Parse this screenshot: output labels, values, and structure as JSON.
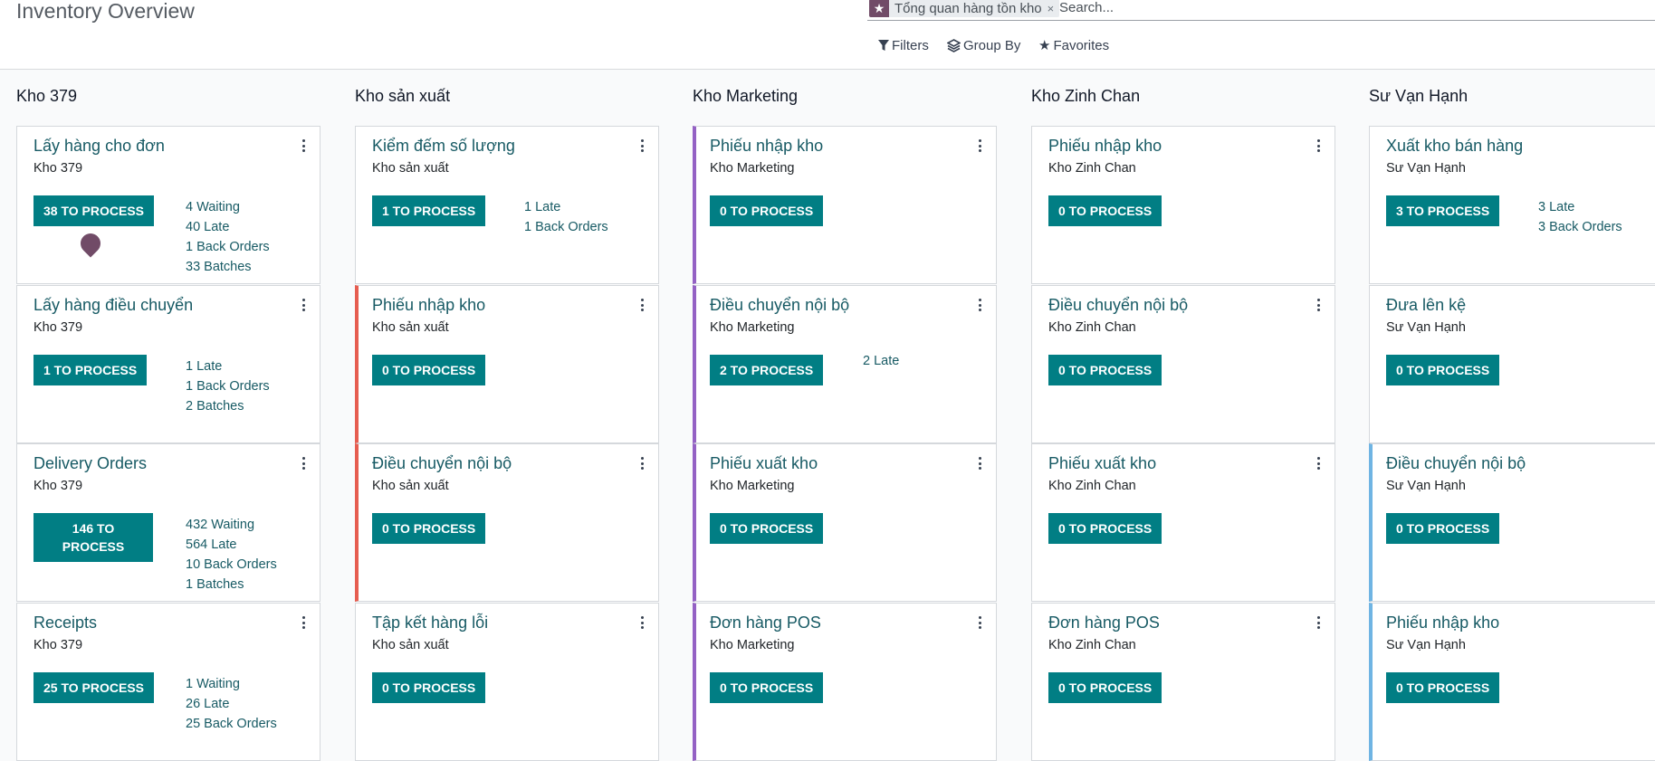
{
  "header": {
    "title": "Inventory Overview",
    "search_facet": "Tổng quan hàng tồn kho",
    "facet_close": "×",
    "search_placeholder": "Search...",
    "filters_label": "Filters",
    "group_by_label": "Group By",
    "favorites_label": "Favorites"
  },
  "colors": {
    "accent": "#017e84",
    "brand": "#714b67",
    "title_text": "#175a64",
    "border_red": "#e65d50",
    "border_purple": "#9461c4",
    "border_blue": "#6fb4e3"
  },
  "columns": [
    {
      "title": "Kho 379",
      "cards": [
        {
          "title": "Lấy hàng cho đơn",
          "warehouse": "Kho 379",
          "button": "38 TO PROCESS",
          "stats": [
            "4 Waiting",
            "40 Late",
            "1 Back Orders",
            "33 Batches"
          ]
        },
        {
          "title": "Lấy hàng điều chuyển",
          "warehouse": "Kho 379",
          "button": "1 TO PROCESS",
          "stats": [
            "1 Late",
            "1 Back Orders",
            "2 Batches"
          ]
        },
        {
          "title": "Delivery Orders",
          "warehouse": "Kho 379",
          "button": "146 TO PROCESS",
          "stats": [
            "432 Waiting",
            "564 Late",
            "10 Back Orders",
            "1 Batches"
          ]
        },
        {
          "title": "Receipts",
          "warehouse": "Kho 379",
          "button": "25 TO PROCESS",
          "stats": [
            "1 Waiting",
            "26 Late",
            "25 Back Orders"
          ]
        }
      ]
    },
    {
      "title": "Kho sản xuất",
      "cards": [
        {
          "title": "Kiểm đếm số lượng",
          "warehouse": "Kho sản xuất",
          "button": "1 TO PROCESS",
          "stats": [
            "1 Late",
            "1 Back Orders"
          ]
        },
        {
          "title": "Phiếu nhập kho",
          "warehouse": "Kho sản xuất",
          "button": "0 TO PROCESS",
          "stats": []
        },
        {
          "title": "Điều chuyển nội bộ",
          "warehouse": "Kho sản xuất",
          "button": "0 TO PROCESS",
          "stats": []
        },
        {
          "title": "Tập kết hàng lỗi",
          "warehouse": "Kho sản xuất",
          "button": "0 TO PROCESS",
          "stats": []
        }
      ]
    },
    {
      "title": "Kho Marketing",
      "cards": [
        {
          "title": "Phiếu nhập kho",
          "warehouse": "Kho Marketing",
          "button": "0 TO PROCESS",
          "stats": []
        },
        {
          "title": "Điều chuyển nội bộ",
          "warehouse": "Kho Marketing",
          "button": "2 TO PROCESS",
          "stats": [
            "2 Late"
          ]
        },
        {
          "title": "Phiếu xuất kho",
          "warehouse": "Kho Marketing",
          "button": "0 TO PROCESS",
          "stats": []
        },
        {
          "title": "Đơn hàng POS",
          "warehouse": "Kho Marketing",
          "button": "0 TO PROCESS",
          "stats": []
        }
      ]
    },
    {
      "title": "Kho Zinh Chan",
      "cards": [
        {
          "title": "Phiếu nhập kho",
          "warehouse": "Kho Zinh Chan",
          "button": "0 TO PROCESS",
          "stats": []
        },
        {
          "title": "Điều chuyển nội bộ",
          "warehouse": "Kho Zinh Chan",
          "button": "0 TO PROCESS",
          "stats": []
        },
        {
          "title": "Phiếu xuất kho",
          "warehouse": "Kho Zinh Chan",
          "button": "0 TO PROCESS",
          "stats": []
        },
        {
          "title": "Đơn hàng POS",
          "warehouse": "Kho Zinh Chan",
          "button": "0 TO PROCESS",
          "stats": []
        }
      ]
    },
    {
      "title": "Sư Vạn Hạnh",
      "cards": [
        {
          "title": "Xuất kho bán hàng",
          "warehouse": "Sư Vạn Hạnh",
          "button": "3 TO PROCESS",
          "stats": [
            "3 Late",
            "3 Back Orders"
          ]
        },
        {
          "title": "Đưa lên kệ",
          "warehouse": "Sư Vạn Hạnh",
          "button": "0 TO PROCESS",
          "stats": []
        },
        {
          "title": "Điều chuyển nội bộ",
          "warehouse": "Sư Vạn Hạnh",
          "button": "0 TO PROCESS",
          "stats": []
        },
        {
          "title": "Phiếu nhập kho",
          "warehouse": "Sư Vạn Hạnh",
          "button": "0 TO PROCESS",
          "stats": []
        }
      ]
    }
  ]
}
